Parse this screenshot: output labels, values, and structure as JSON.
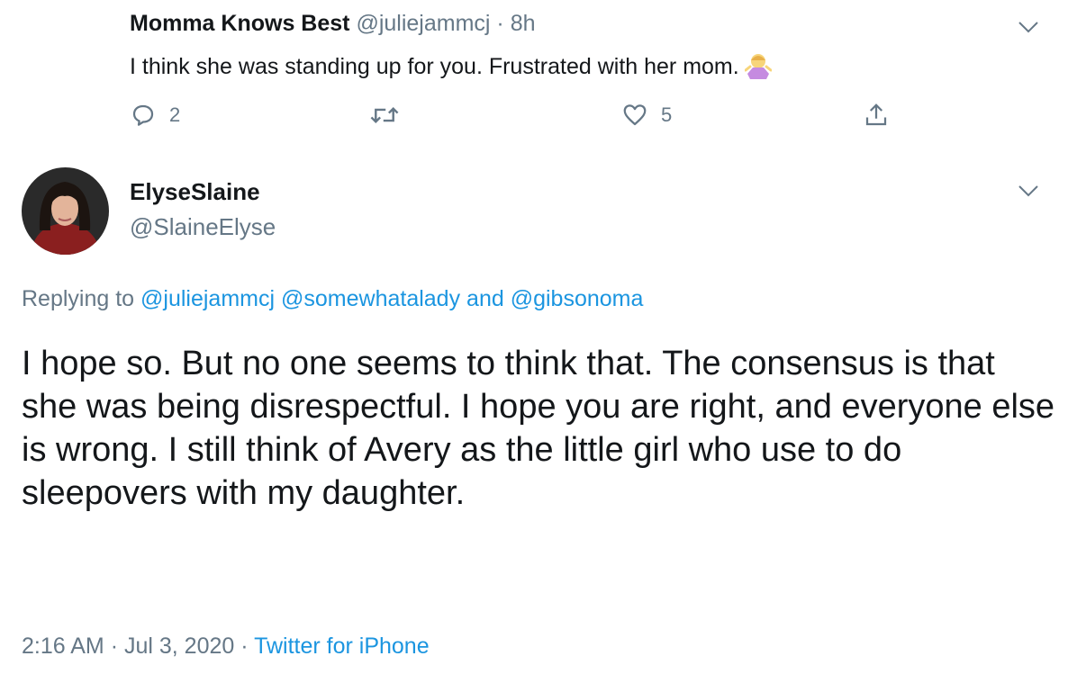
{
  "reply_tweet": {
    "display_name": "Momma Knows Best",
    "handle": "@juliejammcj",
    "separator": "·",
    "time": "8h",
    "text": "I think she was standing up for you. Frustrated with her mom.",
    "emoji_icon": "person-shrugging-emoji-icon",
    "actions": {
      "reply_count": "2",
      "retweet_count": "",
      "like_count": "5"
    }
  },
  "main_tweet": {
    "display_name": "ElyseSlaine",
    "handle": "@SlaineElyse",
    "replying_prefix": "Replying to",
    "reply_mention_1": "@juliejammcj",
    "reply_mention_2": "@somewhatalady",
    "reply_and": "and",
    "reply_mention_3": "@gibsonoma",
    "text": "I hope so. But no one seems to think that. The consensus is that she was being disrespectful. I hope you are right, and everyone else is wrong. I still think of Avery as the little girl who use to do sleepovers with my daughter.",
    "time": "2:16 AM",
    "dot": "·",
    "date": "Jul 3, 2020",
    "source": "Twitter for iPhone"
  },
  "colors": {
    "text": "#14171a",
    "muted": "#657786",
    "link": "#1b95e0"
  }
}
